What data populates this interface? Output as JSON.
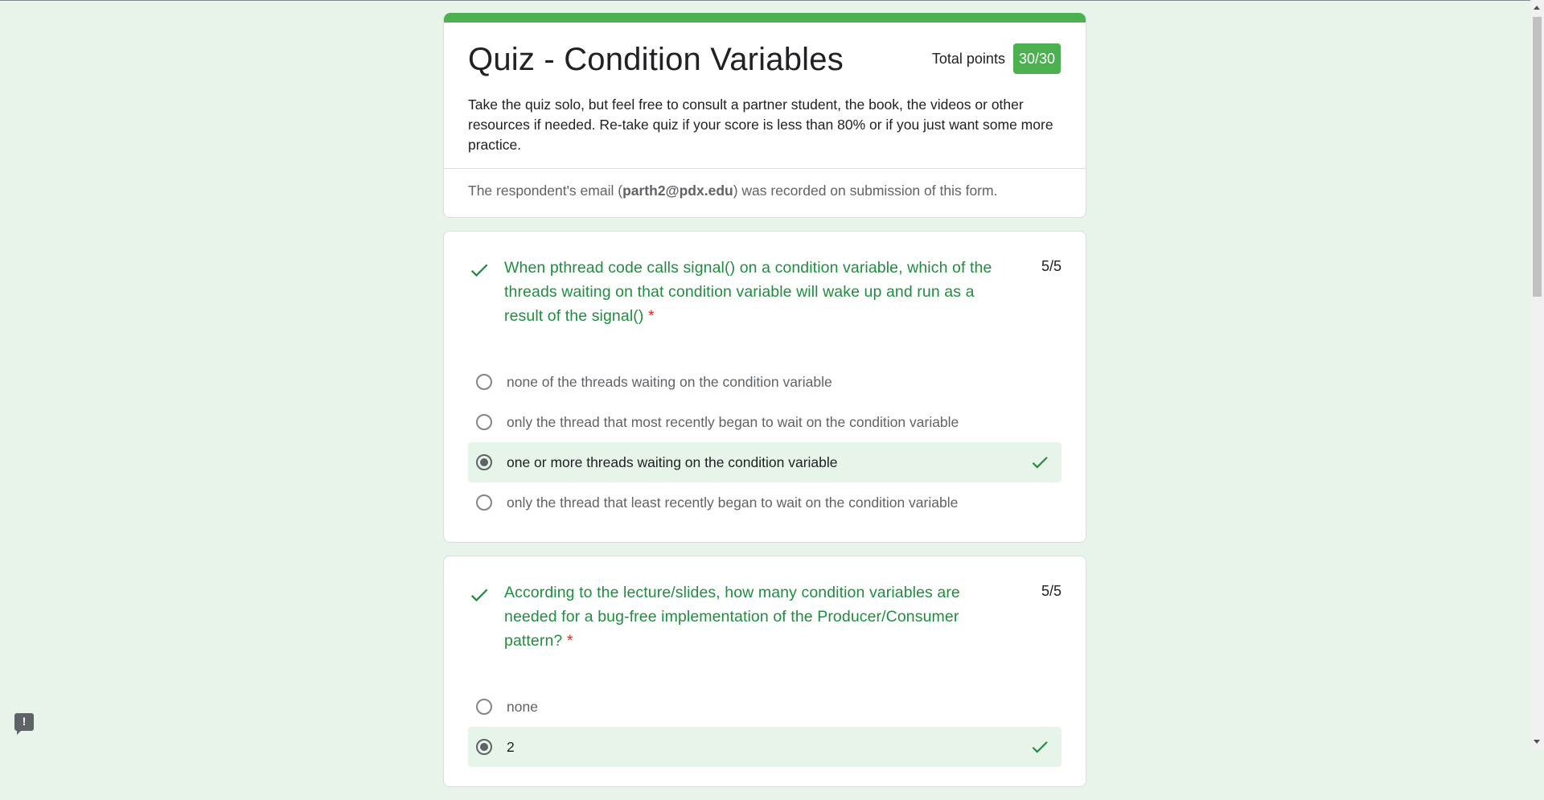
{
  "form": {
    "title": "Quiz - Condition Variables",
    "total_points_label": "Total points",
    "total_points_value": "30/30",
    "description": "Take the quiz solo, but feel free to consult a partner student, the book, the videos or other resources if needed. Re-take quiz if your score is less than 80% or if you just want some more practice.",
    "email_prefix": "The respondent's email (",
    "email": "parth2@pdx.edu",
    "email_suffix": ") was recorded on submission of this form."
  },
  "questions": [
    {
      "title": "When pthread code calls signal() on a condition variable, which of the threads waiting on that condition variable will wake up and run as a result of the signal()",
      "required_mark": "*",
      "score": "5/5",
      "options": [
        "none of the threads waiting on the condition variable",
        "only the thread that most recently began to wait on the condition variable",
        "one or more threads waiting on the condition variable",
        "only the thread that least recently began to wait on the condition variable"
      ],
      "selected_index": 2
    },
    {
      "title": "According to the lecture/slides, how many condition variables are needed for a bug-free implementation of the Producer/Consumer pattern?",
      "required_mark": "*",
      "score": "5/5",
      "options": [
        "none",
        "2"
      ],
      "selected_index": 1
    }
  ],
  "feedback_icon": "!",
  "colors": {
    "background": "#e6f4ea",
    "accent": "#4caf50",
    "correct_text": "#1e8e3e",
    "required": "#d93025"
  },
  "icons": {
    "correct": "check-icon",
    "feedback": "report-problem-icon"
  }
}
